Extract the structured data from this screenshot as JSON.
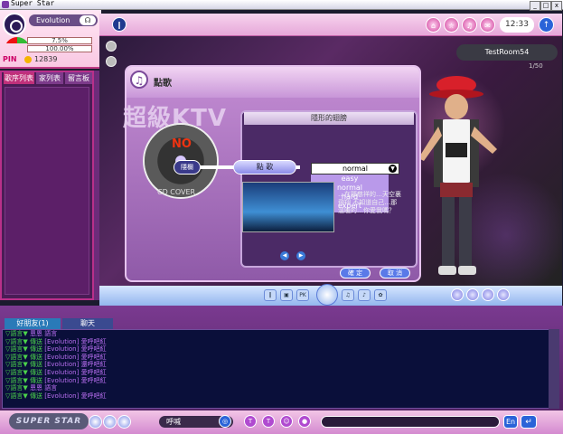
{
  "window": {
    "title": "Super Star",
    "min_label": "_",
    "max_label": "□",
    "close_label": "x"
  },
  "profile": {
    "name": "Evolution",
    "headset_icon": "headset-icon",
    "stat1": "7.5%",
    "stat2": "100.00%",
    "pin_label": "PIN",
    "coins": "12839"
  },
  "left_tabs": [
    "歌序列表",
    "家列表",
    "留言板"
  ],
  "topbar": {
    "clock": "12:33",
    "up_icon": "↑",
    "buttons": [
      "⌂",
      "☆",
      "♫",
      "✉"
    ]
  },
  "room": {
    "name": "TestRoom54",
    "count": "1/50"
  },
  "dialog": {
    "icon": "♫",
    "title": "點歌",
    "watermark": "超級KTV",
    "disc_no": "NO",
    "disc_label": "CD COVER",
    "hidden_button": "隱欄",
    "pick_button": "點 歌",
    "song_title": "隱形的翅膀",
    "difficulty": {
      "selected": "normal",
      "options": [
        "easy",
        "normal",
        "hard",
        "expert"
      ]
    },
    "description": "…在那慈祥的…天空裏 飛翔 不知道自己…那 溫暖的…你愛我嗎？",
    "ok": "確 定",
    "cancel": "取 消",
    "prev": "◀",
    "next": "▶"
  },
  "stagebar": {
    "labels": [
      "‖",
      "▣",
      "PK",
      "♫",
      "♪",
      "✿",
      "☆"
    ]
  },
  "chat": {
    "tabs": [
      "好朋友(1)",
      "聊天"
    ],
    "lines": [
      {
        "prefix": "▽語言▼",
        "name": "",
        "text": "恩恩  語言"
      },
      {
        "prefix": "▽語言▼",
        "name": "傳送",
        "text": "[Evolution] 愛呼吧紅"
      },
      {
        "prefix": "▽語言▼",
        "name": "傳送",
        "text": "[Evolution] 愛呼吧紅"
      },
      {
        "prefix": "▽語言▼",
        "name": "傳送",
        "text": "[Evolution] 愛呼吧紅"
      },
      {
        "prefix": "▽語言▼",
        "name": "傳送",
        "text": "[Evolution] 還呼吧紅"
      },
      {
        "prefix": "▽語言▼",
        "name": "傳送",
        "text": "[Evolution] 愛呼吧紅"
      },
      {
        "prefix": "▽語言▼",
        "name": "傳送",
        "text": "[Evolution] 愛呼吧紅"
      },
      {
        "prefix": "▽語言▼",
        "name": "",
        "text": "恩恩  語言"
      },
      {
        "prefix": "▽語言▼",
        "name": "傳送",
        "text": "[Evolution] 愛呼吧紅"
      }
    ]
  },
  "bottombar": {
    "logo": "SUPER STAR",
    "target": "呼喊",
    "input_value": "",
    "lang": "En",
    "send": "↵",
    "fx": [
      "◎",
      "T",
      "T",
      "☺",
      "●"
    ]
  },
  "colors": {
    "accent": "#c03c86",
    "chat_bg": "#0a0f3a",
    "chat_green": "#4bd34b",
    "chat_purple": "#b86ef0",
    "dialog": "#8f5aa8"
  }
}
